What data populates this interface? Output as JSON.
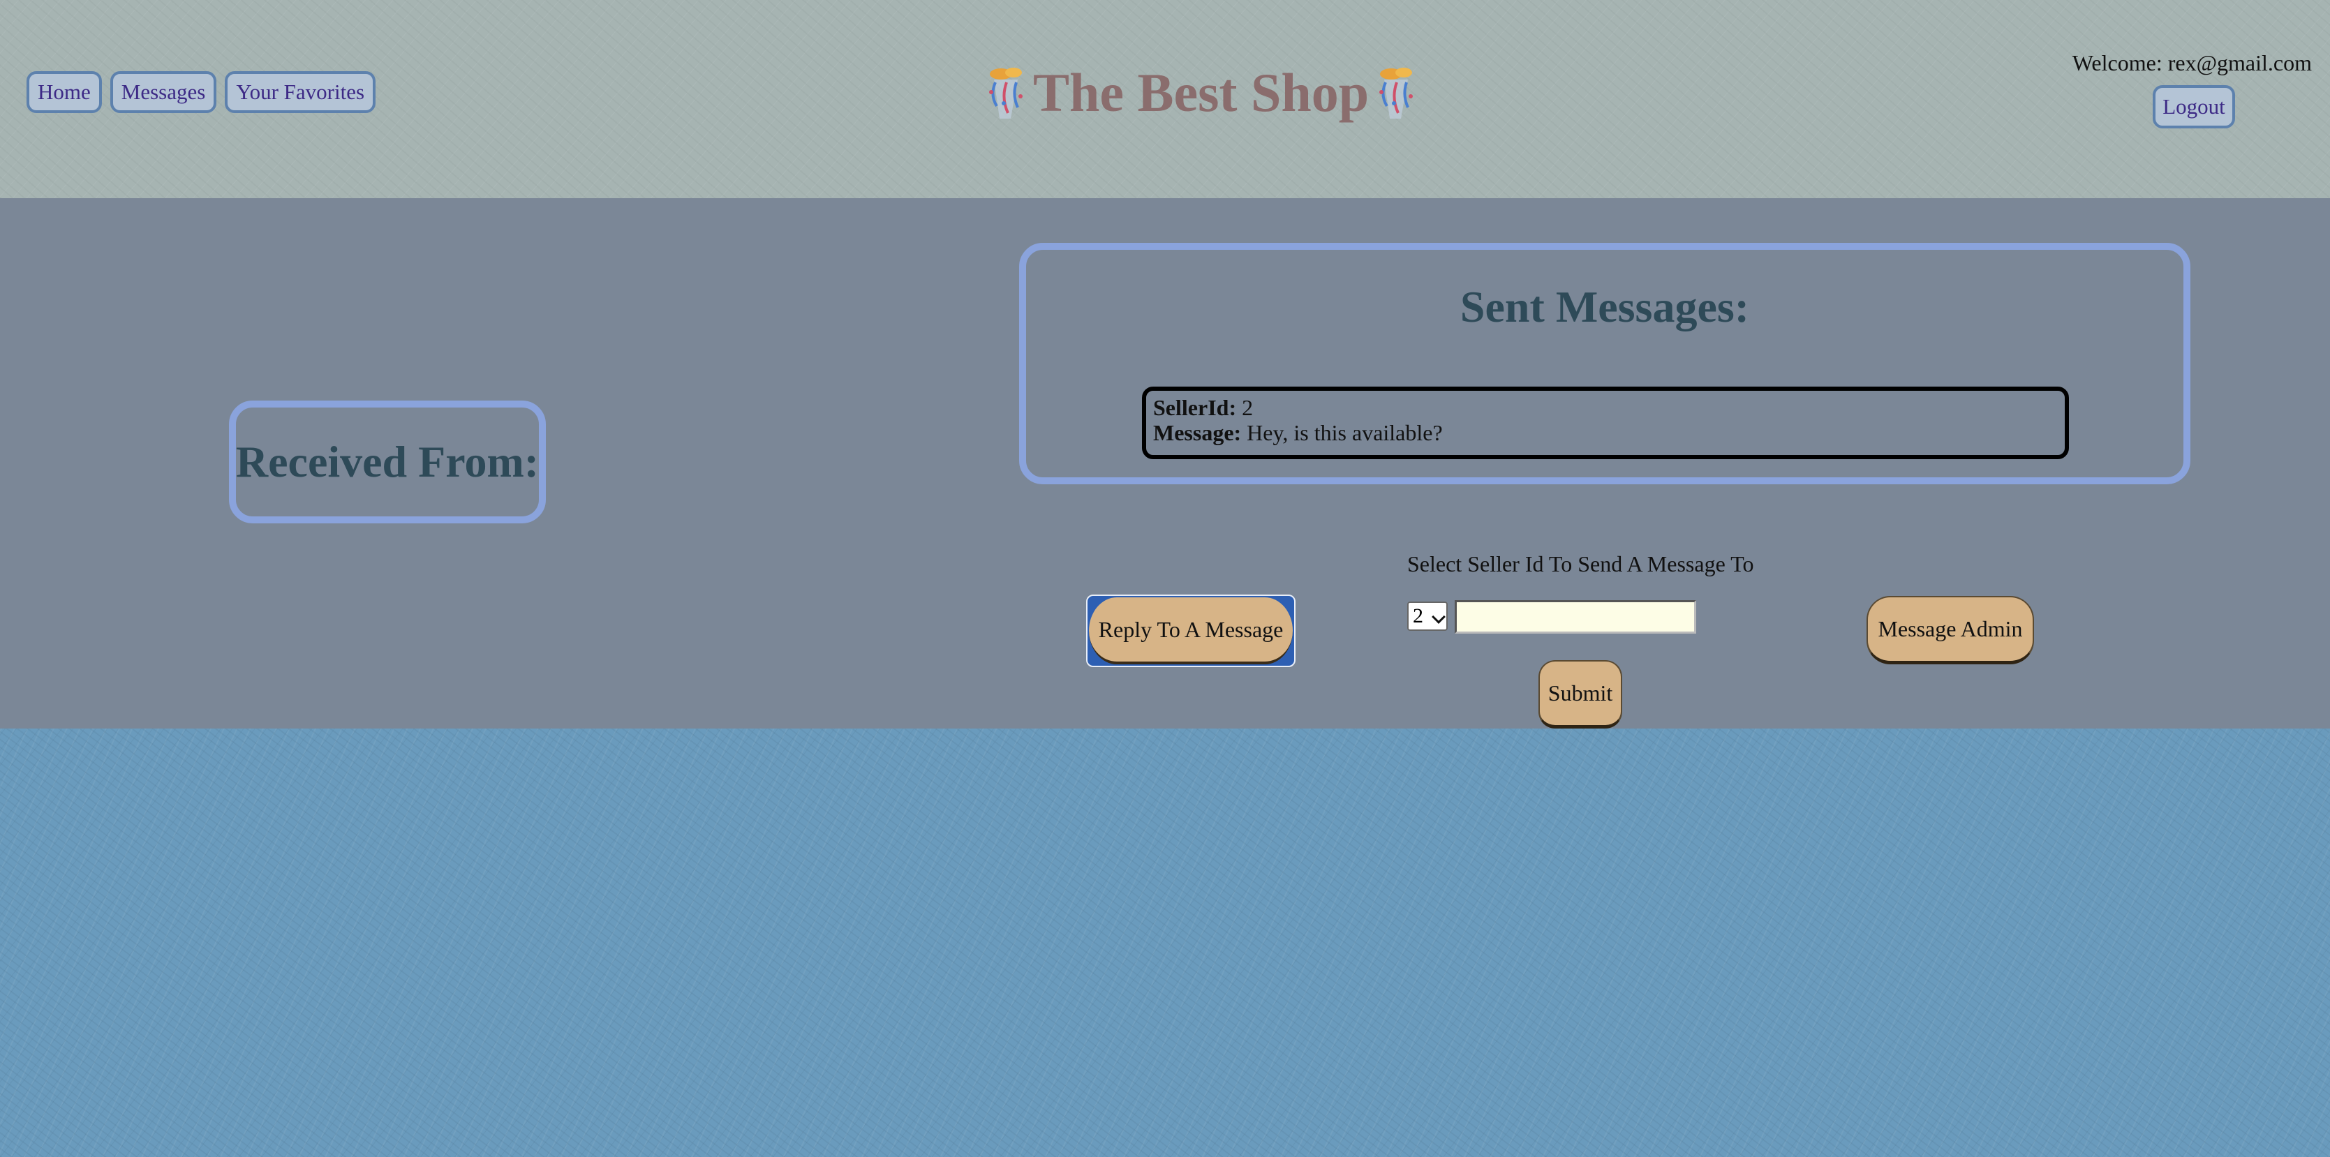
{
  "nav": {
    "home_label": "Home",
    "messages_label": "Messages",
    "favorites_label": "Your Favorites"
  },
  "brand": {
    "title": "The Best Shop",
    "icon": "party-popper-icon"
  },
  "account": {
    "welcome_text": "Welcome: rex@gmail.com",
    "logout_label": "Logout"
  },
  "received": {
    "heading": "Received From:"
  },
  "sent": {
    "heading": "Sent Messages:",
    "messages": [
      {
        "seller_id_label": "SellerId:",
        "seller_id": "2",
        "message_label": "Message:",
        "message": "Hey, is this available?"
      }
    ]
  },
  "compose": {
    "reply_label": "Reply To A Message",
    "select_label": "Select Seller Id To Send A Message To",
    "selected_seller_id": "2",
    "message_value": "",
    "submit_label": "Submit",
    "admin_label": "Message Admin"
  },
  "colors": {
    "header_bg": "#a6b4b2",
    "main_bg": "#7b8797",
    "page_bg": "#6a9bbd",
    "panel_border": "#8aa3dc",
    "heading_text": "#2e4a58",
    "brand_text": "#8a6d6d",
    "nav_button_bg": "#b4c4d6",
    "nav_text": "#3d2a86",
    "action_button_bg": "#d7b487",
    "input_bg": "#fdfde6"
  }
}
